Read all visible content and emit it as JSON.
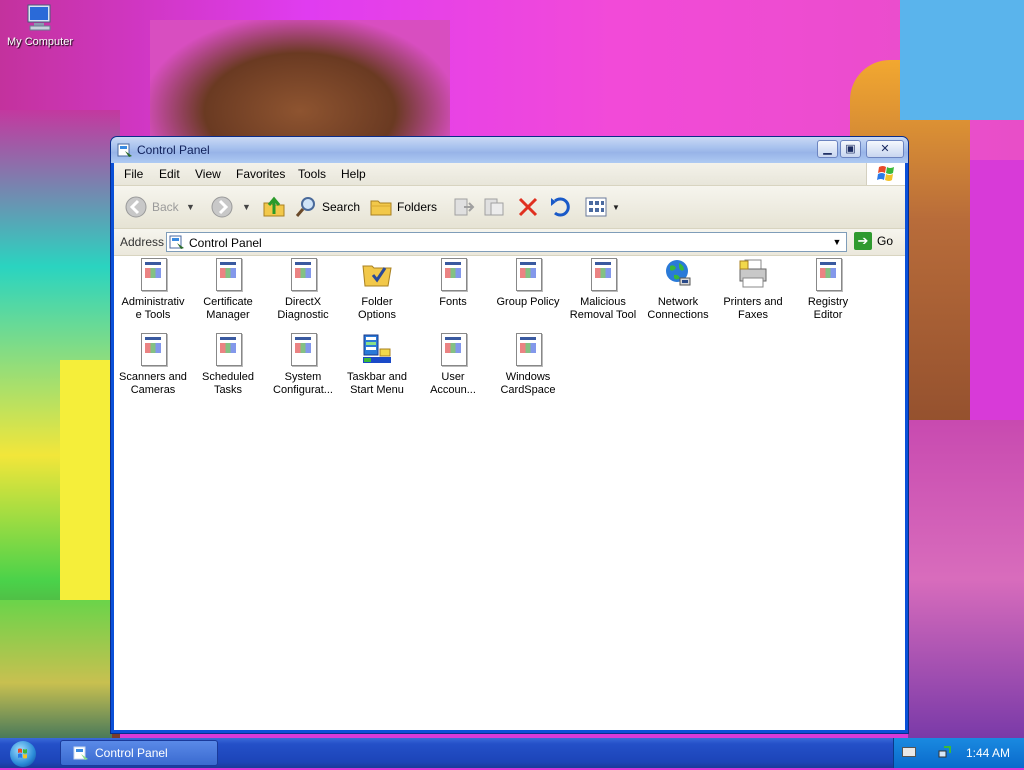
{
  "desktop": {
    "icons": [
      {
        "label": "My Computer",
        "icon": "my-computer-icon"
      }
    ]
  },
  "window": {
    "title": "Control Panel",
    "icon": "control-panel-icon",
    "buttons": {
      "minimize": "minimize-icon",
      "maximize": "maximize-icon",
      "close": "close-icon"
    }
  },
  "menubar": {
    "items": [
      "File",
      "Edit",
      "View",
      "Favorites",
      "Tools",
      "Help"
    ]
  },
  "toolbar": {
    "back_label": "Back",
    "search_label": "Search",
    "folders_label": "Folders"
  },
  "address": {
    "label": "Address",
    "value": "Control Panel",
    "go_label": "Go"
  },
  "items": [
    {
      "label": "Administrative Tools",
      "line1": "Administrativ",
      "line2": "e Tools",
      "icon": "doc"
    },
    {
      "label": "Certificate Manager",
      "line1": "Certificate",
      "line2": "Manager",
      "icon": "doc"
    },
    {
      "label": "DirectX Diagnostic",
      "line1": "DirectX",
      "line2": "Diagnostic",
      "icon": "doc"
    },
    {
      "label": "Folder Options",
      "line1": "Folder",
      "line2": "Options",
      "icon": "folder-options"
    },
    {
      "label": "Fonts",
      "line1": "Fonts",
      "line2": "",
      "icon": "doc"
    },
    {
      "label": "Group Policy",
      "line1": "Group Policy",
      "line2": "",
      "icon": "doc"
    },
    {
      "label": "Malicious Removal Tool",
      "line1": "Malicious",
      "line2": "Removal Tool",
      "icon": "doc"
    },
    {
      "label": "Network Connections",
      "line1": "Network",
      "line2": "Connections",
      "icon": "network"
    },
    {
      "label": "Printers and Faxes",
      "line1": "Printers and",
      "line2": "Faxes",
      "icon": "printer"
    },
    {
      "label": "Registry Editor",
      "line1": "Registry",
      "line2": "Editor",
      "icon": "doc"
    },
    {
      "label": "Scanners and Cameras",
      "line1": "Scanners and",
      "line2": "Cameras",
      "icon": "doc"
    },
    {
      "label": "Scheduled Tasks",
      "line1": "Scheduled",
      "line2": "Tasks",
      "icon": "doc"
    },
    {
      "label": "System Configuration",
      "line1": "System",
      "line2": "Configurat...",
      "icon": "doc"
    },
    {
      "label": "Taskbar and Start Menu",
      "line1": "Taskbar and",
      "line2": "Start Menu",
      "icon": "taskbar"
    },
    {
      "label": "User Accounts",
      "line1": "User",
      "line2": "Accoun...",
      "icon": "doc"
    },
    {
      "label": "Windows CardSpace",
      "line1": "Windows",
      "line2": "CardSpace",
      "icon": "doc"
    }
  ],
  "taskbar": {
    "task_label": "Control Panel",
    "clock": "1:44 AM"
  }
}
